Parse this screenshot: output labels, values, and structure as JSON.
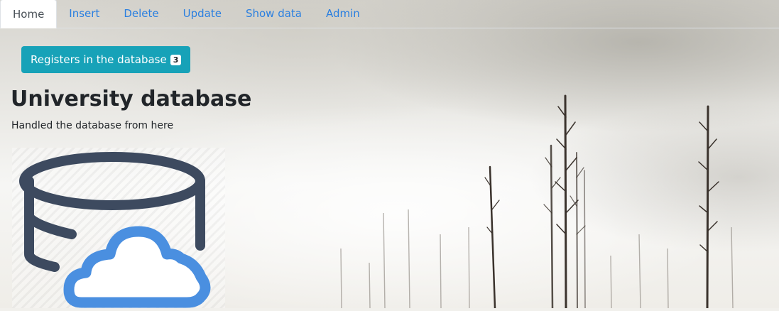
{
  "nav": {
    "tabs": [
      {
        "label": "Home",
        "active": true
      },
      {
        "label": "Insert",
        "active": false
      },
      {
        "label": "Delete",
        "active": false
      },
      {
        "label": "Update",
        "active": false
      },
      {
        "label": "Show data",
        "active": false
      },
      {
        "label": "Admin",
        "active": false
      }
    ]
  },
  "registers_button": {
    "label": "Registers in the database",
    "count": "3"
  },
  "heading": {
    "title": "University database",
    "subtitle": "Handled the database from here"
  },
  "hero_image": {
    "icon": "database-cloud-icon"
  },
  "colors": {
    "accent": "#17a2b8",
    "link": "#2a7fe0",
    "database_icon": "#3d4a5f",
    "cloud_icon": "#4a8fe0"
  }
}
